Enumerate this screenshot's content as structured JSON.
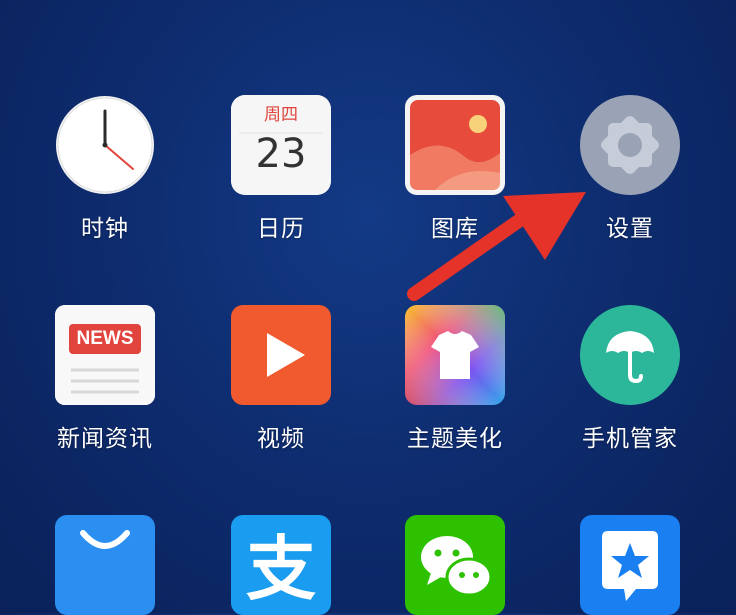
{
  "colors": {
    "background": "#0d2a6b",
    "label_text": "#ffffff",
    "arrow": "#e5332a"
  },
  "rows": [
    [
      {
        "label": "时钟",
        "icon": "clock-icon"
      },
      {
        "label": "日历",
        "icon": "calendar-icon",
        "weekday": "周四",
        "day": "23"
      },
      {
        "label": "图库",
        "icon": "gallery-icon"
      },
      {
        "label": "设置",
        "icon": "settings-gear-icon"
      }
    ],
    [
      {
        "label": "新闻资讯",
        "icon": "news-icon",
        "badge": "NEWS"
      },
      {
        "label": "视频",
        "icon": "video-play-icon"
      },
      {
        "label": "主题美化",
        "icon": "theme-shirt-icon"
      },
      {
        "label": "手机管家",
        "icon": "umbrella-icon"
      }
    ],
    [
      {
        "icon": "shopping-bag-icon"
      },
      {
        "icon": "alipay-icon",
        "glyph": "支"
      },
      {
        "icon": "wechat-icon"
      },
      {
        "icon": "star-chat-icon"
      }
    ]
  ],
  "annotation": {
    "icon": "red-arrow-icon",
    "points_to": "设置"
  }
}
